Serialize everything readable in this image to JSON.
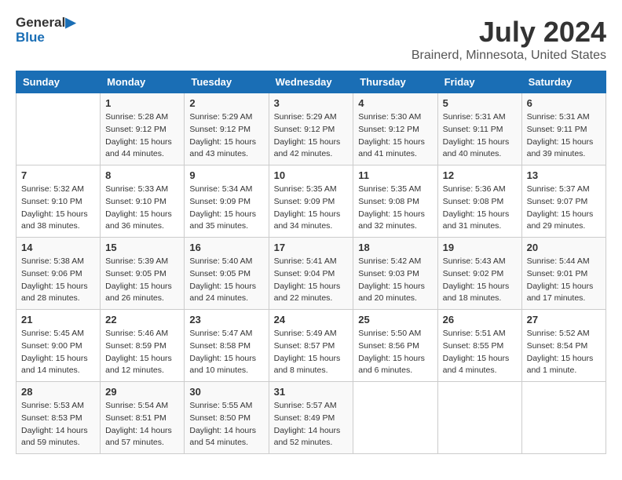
{
  "header": {
    "logo_general": "General",
    "logo_blue": "Blue",
    "month_year": "July 2024",
    "location": "Brainerd, Minnesota, United States"
  },
  "days_of_week": [
    "Sunday",
    "Monday",
    "Tuesday",
    "Wednesday",
    "Thursday",
    "Friday",
    "Saturday"
  ],
  "weeks": [
    [
      {
        "day": "",
        "sunrise": "",
        "sunset": "",
        "daylight": ""
      },
      {
        "day": "1",
        "sunrise": "Sunrise: 5:28 AM",
        "sunset": "Sunset: 9:12 PM",
        "daylight": "Daylight: 15 hours and 44 minutes."
      },
      {
        "day": "2",
        "sunrise": "Sunrise: 5:29 AM",
        "sunset": "Sunset: 9:12 PM",
        "daylight": "Daylight: 15 hours and 43 minutes."
      },
      {
        "day": "3",
        "sunrise": "Sunrise: 5:29 AM",
        "sunset": "Sunset: 9:12 PM",
        "daylight": "Daylight: 15 hours and 42 minutes."
      },
      {
        "day": "4",
        "sunrise": "Sunrise: 5:30 AM",
        "sunset": "Sunset: 9:12 PM",
        "daylight": "Daylight: 15 hours and 41 minutes."
      },
      {
        "day": "5",
        "sunrise": "Sunrise: 5:31 AM",
        "sunset": "Sunset: 9:11 PM",
        "daylight": "Daylight: 15 hours and 40 minutes."
      },
      {
        "day": "6",
        "sunrise": "Sunrise: 5:31 AM",
        "sunset": "Sunset: 9:11 PM",
        "daylight": "Daylight: 15 hours and 39 minutes."
      }
    ],
    [
      {
        "day": "7",
        "sunrise": "Sunrise: 5:32 AM",
        "sunset": "Sunset: 9:10 PM",
        "daylight": "Daylight: 15 hours and 38 minutes."
      },
      {
        "day": "8",
        "sunrise": "Sunrise: 5:33 AM",
        "sunset": "Sunset: 9:10 PM",
        "daylight": "Daylight: 15 hours and 36 minutes."
      },
      {
        "day": "9",
        "sunrise": "Sunrise: 5:34 AM",
        "sunset": "Sunset: 9:09 PM",
        "daylight": "Daylight: 15 hours and 35 minutes."
      },
      {
        "day": "10",
        "sunrise": "Sunrise: 5:35 AM",
        "sunset": "Sunset: 9:09 PM",
        "daylight": "Daylight: 15 hours and 34 minutes."
      },
      {
        "day": "11",
        "sunrise": "Sunrise: 5:35 AM",
        "sunset": "Sunset: 9:08 PM",
        "daylight": "Daylight: 15 hours and 32 minutes."
      },
      {
        "day": "12",
        "sunrise": "Sunrise: 5:36 AM",
        "sunset": "Sunset: 9:08 PM",
        "daylight": "Daylight: 15 hours and 31 minutes."
      },
      {
        "day": "13",
        "sunrise": "Sunrise: 5:37 AM",
        "sunset": "Sunset: 9:07 PM",
        "daylight": "Daylight: 15 hours and 29 minutes."
      }
    ],
    [
      {
        "day": "14",
        "sunrise": "Sunrise: 5:38 AM",
        "sunset": "Sunset: 9:06 PM",
        "daylight": "Daylight: 15 hours and 28 minutes."
      },
      {
        "day": "15",
        "sunrise": "Sunrise: 5:39 AM",
        "sunset": "Sunset: 9:05 PM",
        "daylight": "Daylight: 15 hours and 26 minutes."
      },
      {
        "day": "16",
        "sunrise": "Sunrise: 5:40 AM",
        "sunset": "Sunset: 9:05 PM",
        "daylight": "Daylight: 15 hours and 24 minutes."
      },
      {
        "day": "17",
        "sunrise": "Sunrise: 5:41 AM",
        "sunset": "Sunset: 9:04 PM",
        "daylight": "Daylight: 15 hours and 22 minutes."
      },
      {
        "day": "18",
        "sunrise": "Sunrise: 5:42 AM",
        "sunset": "Sunset: 9:03 PM",
        "daylight": "Daylight: 15 hours and 20 minutes."
      },
      {
        "day": "19",
        "sunrise": "Sunrise: 5:43 AM",
        "sunset": "Sunset: 9:02 PM",
        "daylight": "Daylight: 15 hours and 18 minutes."
      },
      {
        "day": "20",
        "sunrise": "Sunrise: 5:44 AM",
        "sunset": "Sunset: 9:01 PM",
        "daylight": "Daylight: 15 hours and 17 minutes."
      }
    ],
    [
      {
        "day": "21",
        "sunrise": "Sunrise: 5:45 AM",
        "sunset": "Sunset: 9:00 PM",
        "daylight": "Daylight: 15 hours and 14 minutes."
      },
      {
        "day": "22",
        "sunrise": "Sunrise: 5:46 AM",
        "sunset": "Sunset: 8:59 PM",
        "daylight": "Daylight: 15 hours and 12 minutes."
      },
      {
        "day": "23",
        "sunrise": "Sunrise: 5:47 AM",
        "sunset": "Sunset: 8:58 PM",
        "daylight": "Daylight: 15 hours and 10 minutes."
      },
      {
        "day": "24",
        "sunrise": "Sunrise: 5:49 AM",
        "sunset": "Sunset: 8:57 PM",
        "daylight": "Daylight: 15 hours and 8 minutes."
      },
      {
        "day": "25",
        "sunrise": "Sunrise: 5:50 AM",
        "sunset": "Sunset: 8:56 PM",
        "daylight": "Daylight: 15 hours and 6 minutes."
      },
      {
        "day": "26",
        "sunrise": "Sunrise: 5:51 AM",
        "sunset": "Sunset: 8:55 PM",
        "daylight": "Daylight: 15 hours and 4 minutes."
      },
      {
        "day": "27",
        "sunrise": "Sunrise: 5:52 AM",
        "sunset": "Sunset: 8:54 PM",
        "daylight": "Daylight: 15 hours and 1 minute."
      }
    ],
    [
      {
        "day": "28",
        "sunrise": "Sunrise: 5:53 AM",
        "sunset": "Sunset: 8:53 PM",
        "daylight": "Daylight: 14 hours and 59 minutes."
      },
      {
        "day": "29",
        "sunrise": "Sunrise: 5:54 AM",
        "sunset": "Sunset: 8:51 PM",
        "daylight": "Daylight: 14 hours and 57 minutes."
      },
      {
        "day": "30",
        "sunrise": "Sunrise: 5:55 AM",
        "sunset": "Sunset: 8:50 PM",
        "daylight": "Daylight: 14 hours and 54 minutes."
      },
      {
        "day": "31",
        "sunrise": "Sunrise: 5:57 AM",
        "sunset": "Sunset: 8:49 PM",
        "daylight": "Daylight: 14 hours and 52 minutes."
      },
      {
        "day": "",
        "sunrise": "",
        "sunset": "",
        "daylight": ""
      },
      {
        "day": "",
        "sunrise": "",
        "sunset": "",
        "daylight": ""
      },
      {
        "day": "",
        "sunrise": "",
        "sunset": "",
        "daylight": ""
      }
    ]
  ]
}
